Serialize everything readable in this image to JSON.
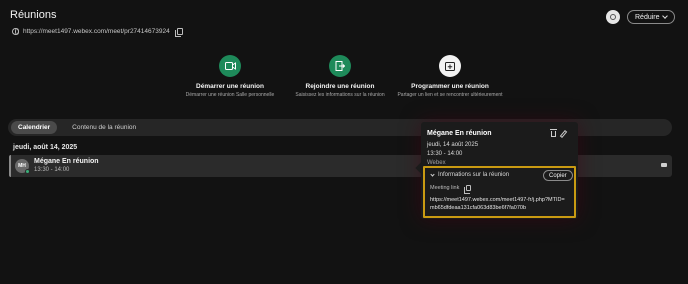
{
  "header": {
    "title": "Réunions",
    "meeting_url": "https://meet1497.webex.com/meet/pr27414673924",
    "collapse_label": "Réduire"
  },
  "actions": [
    {
      "label": "Démarrer une réunion",
      "sub": "Démarrer une réunion Salle personnelle",
      "icon": "video-camera-icon"
    },
    {
      "label": "Rejoindre une réunion",
      "sub": "Saisissez les informations sur la réunion",
      "icon": "join-door-icon"
    },
    {
      "label": "Programmer une réunion",
      "sub": "Partager un lien et se rencontrer ultérieurement",
      "icon": "calendar-plus-icon"
    }
  ],
  "tabs": [
    {
      "label": "Calendrier",
      "active": true
    },
    {
      "label": "Contenu de la réunion",
      "active": false
    }
  ],
  "calendar": {
    "date_header": "jeudi, août 14, 2025",
    "meetings": [
      {
        "avatar": "MH",
        "title": "Mégane En réunion",
        "time": "13:30 - 14:00"
      }
    ]
  },
  "popup": {
    "title": "Mégane En réunion",
    "date": "jeudi, 14 août 2025",
    "time": "13:30 - 14:00",
    "type": "Webex",
    "info_header": "Informations sur la réunion",
    "copy_label": "Copier",
    "meeting_link_label": "Meeting link",
    "meeting_link": "https://meet1497.webex.com/meet1497-fr/j.php?MTID=mb65dfdeaa131cfa063d83be6f7fa070b"
  },
  "colors": {
    "background": "#121212",
    "accent_green": "#1e8a5a",
    "highlight_border": "#c99a12"
  }
}
